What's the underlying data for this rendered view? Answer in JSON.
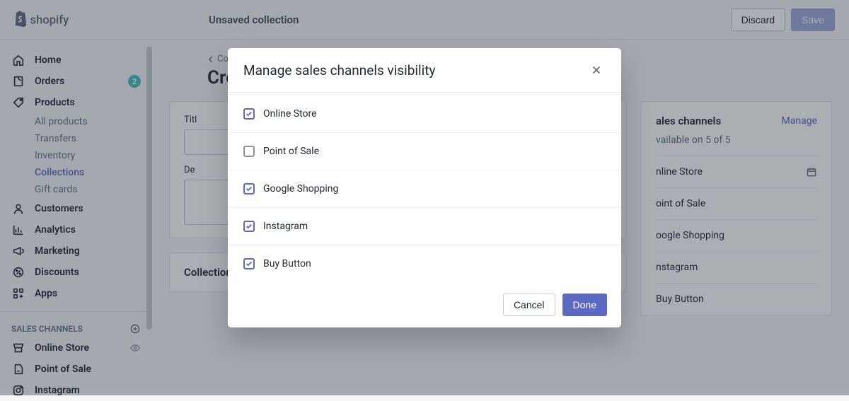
{
  "brand": "shopify",
  "topbar": {
    "title": "Unsaved collection",
    "discard": "Discard",
    "save": "Save"
  },
  "nav": {
    "items": [
      {
        "label": "Home"
      },
      {
        "label": "Orders",
        "badge": "2"
      },
      {
        "label": "Products"
      },
      {
        "label": "Customers"
      },
      {
        "label": "Analytics"
      },
      {
        "label": "Marketing"
      },
      {
        "label": "Discounts"
      },
      {
        "label": "Apps"
      }
    ],
    "subitems": [
      {
        "label": "All products"
      },
      {
        "label": "Transfers"
      },
      {
        "label": "Inventory"
      },
      {
        "label": "Collections"
      },
      {
        "label": "Gift cards"
      }
    ],
    "channels_heading": "SALES CHANNELS",
    "channels": [
      {
        "label": "Online Store"
      },
      {
        "label": "Point of Sale"
      },
      {
        "label": "Instagram"
      }
    ]
  },
  "page": {
    "breadcrumb": "Col",
    "title": "Cre",
    "title_label": "Titl",
    "desc_label": "De",
    "collection_type": "Collection type"
  },
  "side": {
    "heading": "ales channels",
    "manage": "Manage",
    "subtext": "vailable on 5 of 5",
    "items": [
      "nline Store",
      "oint of Sale",
      "oogle Shopping",
      "nstagram",
      "Buy Button"
    ]
  },
  "modal": {
    "title": "Manage sales channels visibility",
    "options": [
      {
        "label": "Online Store",
        "checked": true
      },
      {
        "label": "Point of Sale",
        "checked": false
      },
      {
        "label": "Google Shopping",
        "checked": true
      },
      {
        "label": "Instagram",
        "checked": true
      },
      {
        "label": "Buy Button",
        "checked": true
      }
    ],
    "cancel": "Cancel",
    "done": "Done"
  }
}
